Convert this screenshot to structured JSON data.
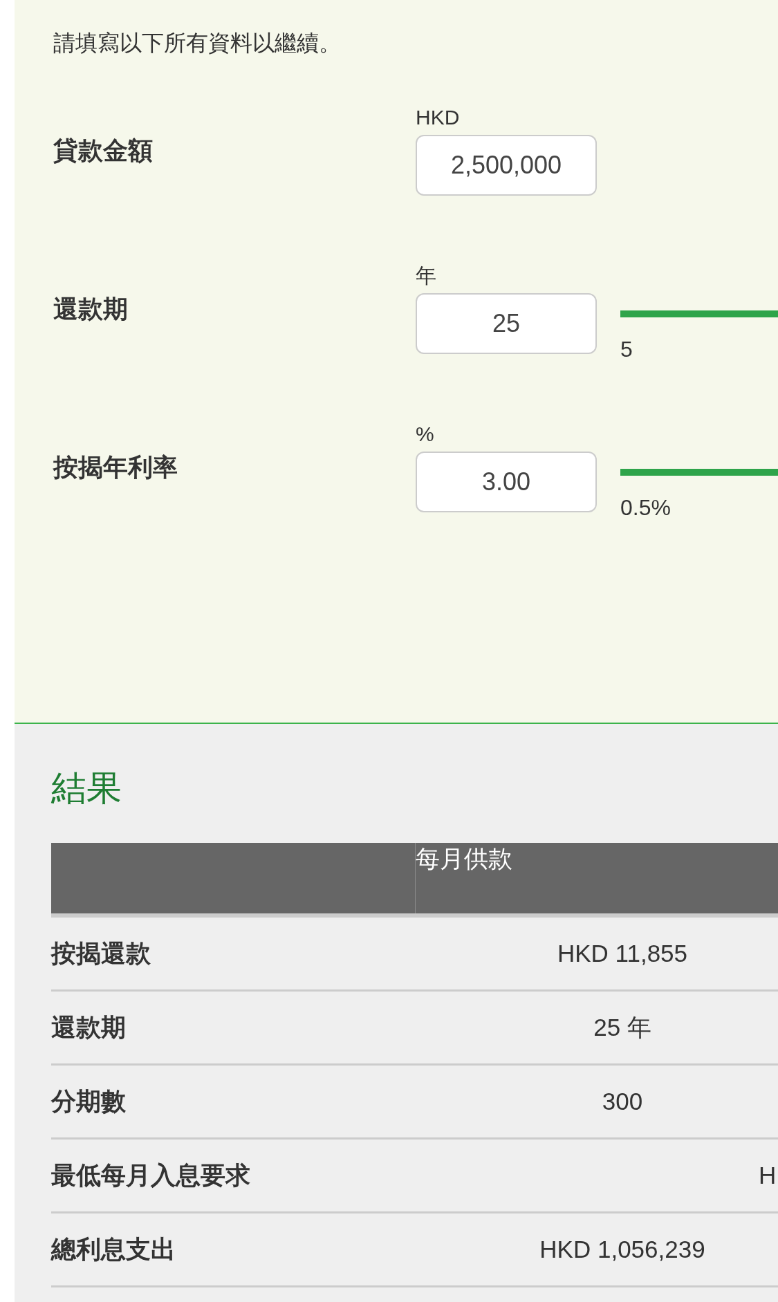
{
  "instruction": "請填寫以下所有資料以繼續。",
  "form": [
    {
      "kind": "input",
      "label": "貸款金額",
      "unit": "HKD",
      "value": "2,500,000"
    },
    {
      "kind": "slider",
      "label": "還款期",
      "unit": "年",
      "value": "25",
      "min_label": "5"
    },
    {
      "kind": "slider",
      "label": "按揭年利率",
      "unit": "%",
      "value": "3.00",
      "min_label": "0.5%"
    }
  ],
  "results": {
    "title": "結果",
    "table": {
      "columns": [
        "每月供款"
      ],
      "rows": [
        {
          "label": "按揭還款",
          "value": "HKD 11,855"
        },
        {
          "label": "還款期",
          "value": "25 年"
        },
        {
          "label": "分期數",
          "value": "300"
        },
        {
          "label": "最低每月入息要求",
          "column_3": "H"
        },
        {
          "label": "總利息支出",
          "value": "HKD 1,056,239"
        }
      ]
    }
  }
}
